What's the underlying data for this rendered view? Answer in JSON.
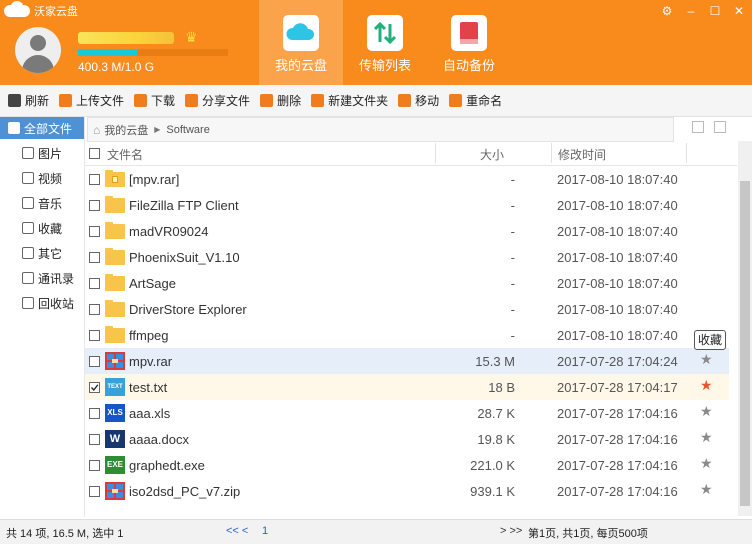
{
  "app": {
    "title": "沃家云盘"
  },
  "user": {
    "quota_text": "400.3 M/1.0 G",
    "quota_fraction": 0.39
  },
  "tabs": [
    {
      "label": "我的云盘",
      "icon": "cloud-icon"
    },
    {
      "label": "传输列表",
      "icon": "transfer-arrows-icon"
    },
    {
      "label": "自动备份",
      "icon": "backup-book-icon"
    }
  ],
  "toolbar": [
    {
      "label": "刷新",
      "icon": "refresh-icon",
      "color": "#444444"
    },
    {
      "label": "上传文件",
      "icon": "upload-icon",
      "color": "#f07c1d"
    },
    {
      "label": "下载",
      "icon": "download-icon",
      "color": "#f07c1d"
    },
    {
      "label": "分享文件",
      "icon": "share-icon",
      "color": "#f07c1d"
    },
    {
      "label": "删除",
      "icon": "trash-icon",
      "color": "#f07c1d"
    },
    {
      "label": "新建文件夹",
      "icon": "new-folder-icon",
      "color": "#f07c1d"
    },
    {
      "label": "移动",
      "icon": "move-icon",
      "color": "#f07c1d"
    },
    {
      "label": "重命名",
      "icon": "rename-icon",
      "color": "#f07c1d"
    }
  ],
  "sidebar": [
    {
      "label": "全部文件",
      "icon": "all-files-icon"
    },
    {
      "label": "图片",
      "icon": "image-icon"
    },
    {
      "label": "视频",
      "icon": "video-icon"
    },
    {
      "label": "音乐",
      "icon": "music-icon"
    },
    {
      "label": "收藏",
      "icon": "heart-icon"
    },
    {
      "label": "其它",
      "icon": "other-icon"
    },
    {
      "label": "通讯录",
      "icon": "contacts-icon"
    },
    {
      "label": "回收站",
      "icon": "recycle-bin-icon"
    }
  ],
  "breadcrumb": {
    "root": "我的云盘",
    "current": "Software"
  },
  "columns": {
    "name": "文件名",
    "size": "大小",
    "modified": "修改时间"
  },
  "files": [
    {
      "name": "[mpv.rar]",
      "size": "-",
      "modified": "2017-08-10 18:07:40",
      "type": "folder-archive"
    },
    {
      "name": "FileZilla FTP Client",
      "size": "-",
      "modified": "2017-08-10 18:07:40",
      "type": "folder"
    },
    {
      "name": "madVR09024",
      "size": "-",
      "modified": "2017-08-10 18:07:40",
      "type": "folder"
    },
    {
      "name": "PhoenixSuit_V1.10",
      "size": "-",
      "modified": "2017-08-10 18:07:40",
      "type": "folder"
    },
    {
      "name": "ArtSage",
      "size": "-",
      "modified": "2017-08-10 18:07:40",
      "type": "folder"
    },
    {
      "name": "DriverStore Explorer",
      "size": "-",
      "modified": "2017-08-10 18:07:40",
      "type": "folder"
    },
    {
      "name": "ffmpeg",
      "size": "-",
      "modified": "2017-08-10 18:07:40",
      "type": "folder"
    },
    {
      "name": "mpv.rar",
      "size": "15.3 M",
      "modified": "2017-07-28 17:04:24",
      "type": "archive",
      "star": true
    },
    {
      "name": "test.txt",
      "size": "18 B",
      "modified": "2017-07-28 17:04:17",
      "type": "txt",
      "star": true,
      "starred": true,
      "checked": true
    },
    {
      "name": "aaa.xls",
      "size": "28.7 K",
      "modified": "2017-07-28 17:04:16",
      "type": "xls",
      "star": true
    },
    {
      "name": "aaaa.docx",
      "size": "19.8 K",
      "modified": "2017-07-28 17:04:16",
      "type": "docx",
      "star": true
    },
    {
      "name": "graphedt.exe",
      "size": "221.0 K",
      "modified": "2017-07-28 17:04:16",
      "type": "exe",
      "star": true
    },
    {
      "name": "iso2dsd_PC_v7.zip",
      "size": "939.1 K",
      "modified": "2017-07-28 17:04:16",
      "type": "archive",
      "star": true
    }
  ],
  "icon_labels": {
    "txt": "TEXT",
    "xls": "XLS",
    "docx": "W",
    "exe": "EXE"
  },
  "tooltip": "收藏",
  "status": {
    "summary": "共 14 项, 16.5 M, 选中 1",
    "prev": "<<  <",
    "page": "1",
    "next": ">  >>",
    "info": "第1页, 共1页, 每页500项"
  }
}
